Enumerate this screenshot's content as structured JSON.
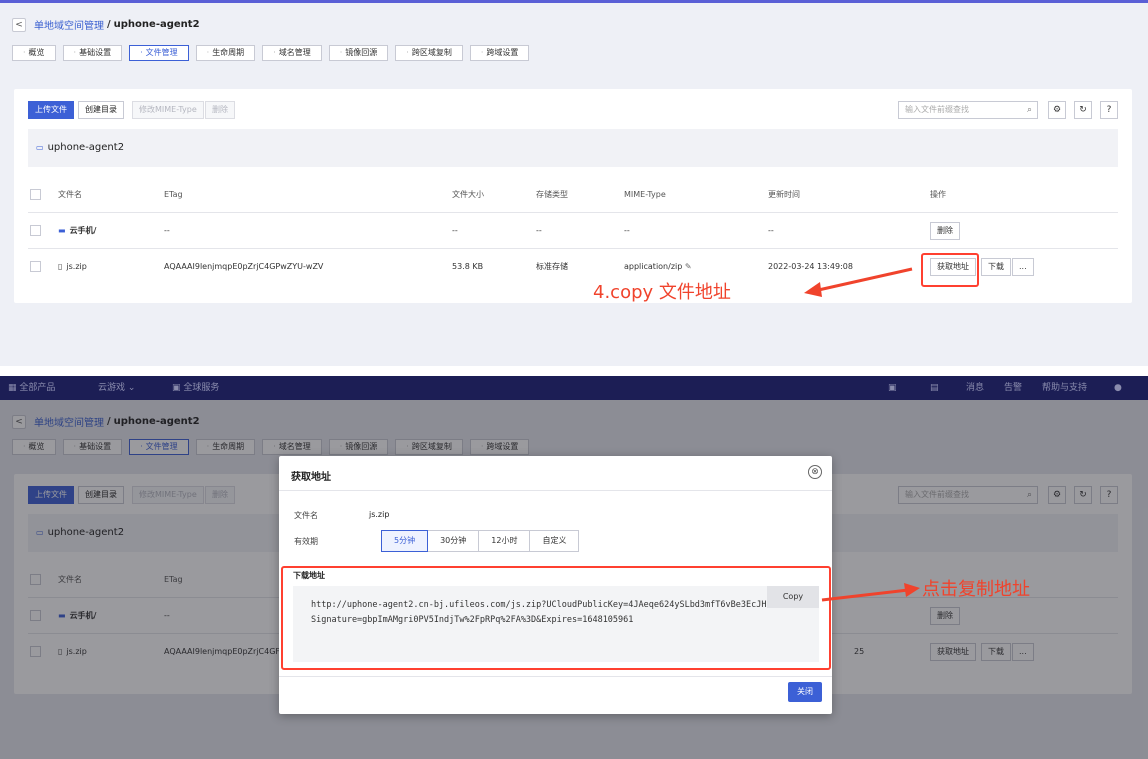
{
  "breadcrumb": {
    "back": "<",
    "parent": "单地域空间管理",
    "sep": "/",
    "current": "uphone-agent2"
  },
  "tabs": [
    {
      "label": "概览"
    },
    {
      "label": "基础设置"
    },
    {
      "label": "文件管理"
    },
    {
      "label": "生命周期"
    },
    {
      "label": "域名管理"
    },
    {
      "label": "镜像回源"
    },
    {
      "label": "跨区域复制"
    },
    {
      "label": "跨域设置"
    }
  ],
  "active_tab": "文件管理",
  "toolbar": {
    "upload": "上传文件",
    "mkdir": "创建目录",
    "mime": "修改MIME-Type",
    "delete": "删除",
    "search_placeholder": "输入文件前缀查找"
  },
  "bucket_path": "uphone-agent2",
  "table": {
    "headers": [
      "文件名",
      "ETag",
      "文件大小",
      "存储类型",
      "MIME-Type",
      "更新时间",
      "操作"
    ],
    "rows": [
      {
        "name": "云手机/",
        "etag": "--",
        "size": "--",
        "storage": "--",
        "mime": "--",
        "updated": "--",
        "actions": [
          "删除"
        ]
      },
      {
        "name": "js.zip",
        "etag": "AQAAAI9lenjmqpE0pZrjC4GPwZYU-wZV",
        "size": "53.8 KB",
        "storage": "标准存储",
        "mime": "application/zip",
        "updated": "2022-03-24 13:49:08",
        "actions": [
          "获取地址",
          "下载",
          "..."
        ]
      }
    ]
  },
  "bottom_table": {
    "etag_truncated": "AQAAAI9lenjmqpE0pZrjC4GF",
    "updated_tail": "25"
  },
  "annotations": {
    "step4": "4.copy 文件地址",
    "click_copy": "点击复制地址"
  },
  "navbar": {
    "all_products": "全部产品",
    "cloud_game": "云游戏",
    "global": "全球服务",
    "messages": "消息",
    "alerts": "告警",
    "help": "帮助与支持"
  },
  "modal": {
    "title": "获取地址",
    "close_icon": "⊗",
    "filename_label": "文件名",
    "filename": "js.zip",
    "validity_label": "有效期",
    "validity_options": [
      "5分钟",
      "30分钟",
      "12小时",
      "自定义"
    ],
    "validity_selected": "5分钟",
    "download_label": "下载地址",
    "url": "http://uphone-agent2.cn-bj.ufileos.com/js.zip?UCloudPublicKey=4JAeqe624ySLbd3mfT6vBe3EcJHt&Signature=gbpImAMgri0PV5IndjTw%2FpRPq%2FA%3D&Expires=1648105961",
    "copy": "Copy",
    "close_button": "关闭"
  },
  "colors": {
    "accent": "#3c60d6",
    "annotation": "#f0432c",
    "navbar": "#1c1e55"
  }
}
